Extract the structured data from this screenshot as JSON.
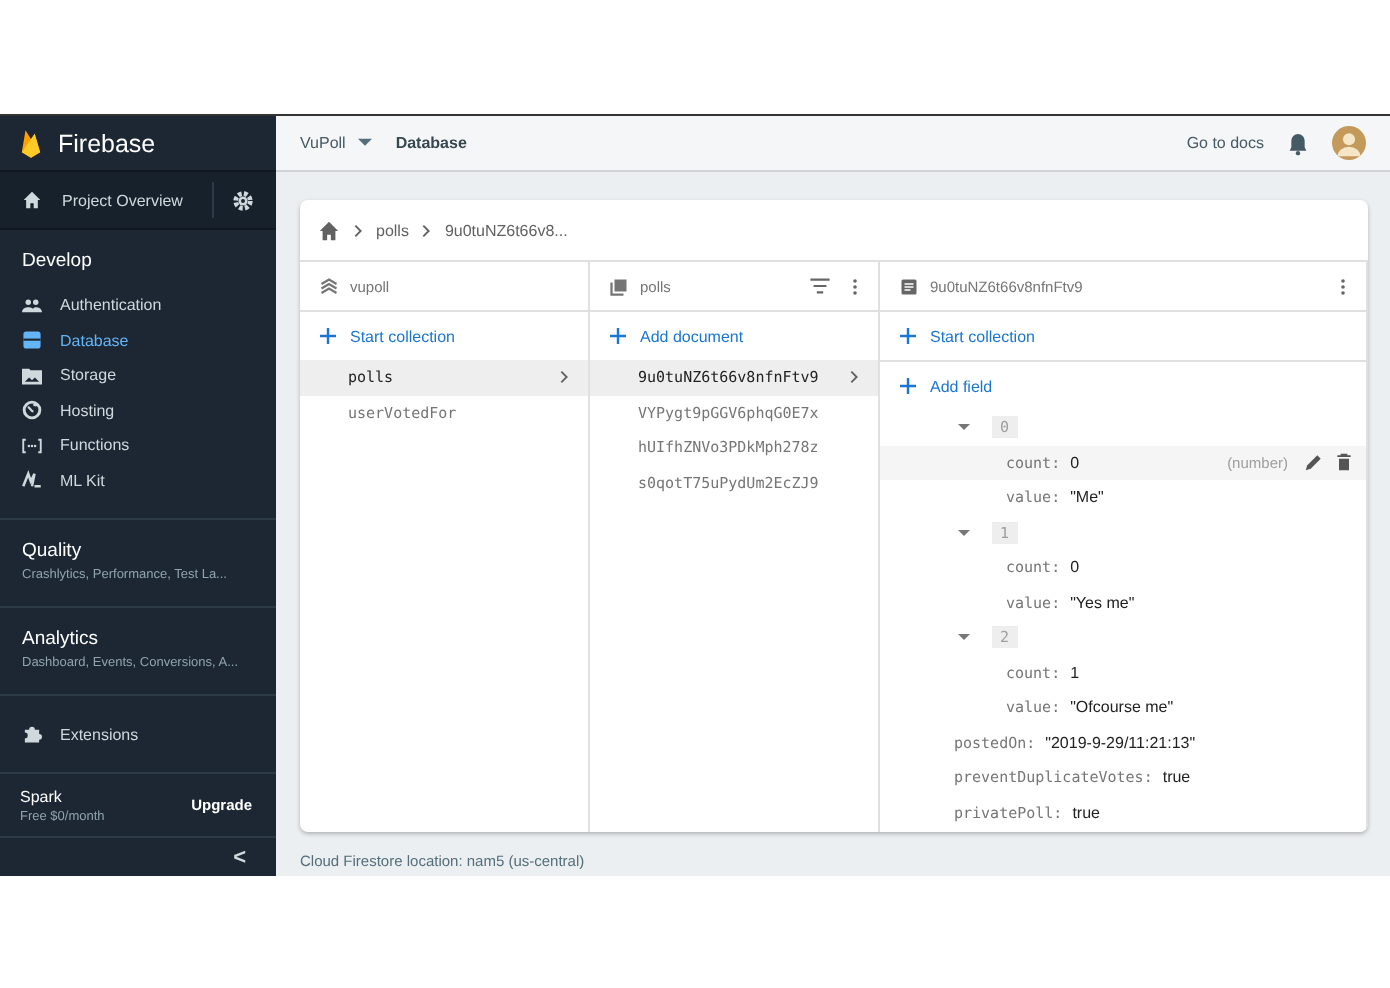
{
  "sidebar": {
    "brand": "Firebase",
    "overview": "Project Overview",
    "develop": {
      "title": "Develop",
      "items": [
        {
          "label": "Authentication",
          "selected": false
        },
        {
          "label": "Database",
          "selected": true
        },
        {
          "label": "Storage",
          "selected": false
        },
        {
          "label": "Hosting",
          "selected": false
        },
        {
          "label": "Functions",
          "selected": false
        },
        {
          "label": "ML Kit",
          "selected": false
        }
      ]
    },
    "sections": [
      {
        "title": "Quality",
        "subtitle": "Crashlytics, Performance, Test La..."
      },
      {
        "title": "Analytics",
        "subtitle": "Dashboard, Events, Conversions, A..."
      }
    ],
    "extensions": "Extensions",
    "plan": {
      "name": "Spark",
      "price": "Free $0/month",
      "action": "Upgrade"
    },
    "collapse": "<"
  },
  "topbar": {
    "project": "VuPoll",
    "page": "Database",
    "docs": "Go to docs"
  },
  "breadcrumb": [
    "polls",
    "9u0tuNZ6t66v8..."
  ],
  "columns": [
    {
      "title": "vupoll",
      "action": "Start collection",
      "items": [
        {
          "label": "polls",
          "selected": true
        },
        {
          "label": "userVotedFor",
          "selected": false
        }
      ]
    },
    {
      "title": "polls",
      "action": "Add document",
      "items": [
        {
          "label": "9u0tuNZ6t66v8nfnFtv9",
          "selected": true
        },
        {
          "label": "VYPygt9pGGV6phqG0E7x",
          "selected": false
        },
        {
          "label": "hUIfhZNVo3PDkMph278z",
          "selected": false
        },
        {
          "label": "s0qotT75uPydUm2EcZJ9",
          "selected": false
        }
      ]
    }
  ],
  "document": {
    "title": "9u0tuNZ6t66v8nfnFtv9",
    "action": "Start collection",
    "add_field": "Add field",
    "fields": [
      {
        "kind": "map",
        "key": "0",
        "expanded": true,
        "children": [
          {
            "kind": "value",
            "key": "count:",
            "value": "0",
            "selected": true,
            "type": "(number)"
          },
          {
            "kind": "value",
            "key": "value:",
            "value": "\"Me\"",
            "selected": false
          }
        ]
      },
      {
        "kind": "map",
        "key": "1",
        "expanded": true,
        "children": [
          {
            "kind": "value",
            "key": "count:",
            "value": "0",
            "selected": false
          },
          {
            "kind": "value",
            "key": "value:",
            "value": "\"Yes me\"",
            "selected": false
          }
        ]
      },
      {
        "kind": "map",
        "key": "2",
        "expanded": true,
        "children": [
          {
            "kind": "value",
            "key": "count:",
            "value": "1",
            "selected": false
          },
          {
            "kind": "value",
            "key": "value:",
            "value": "\"Ofcourse me\"",
            "selected": false
          }
        ]
      },
      {
        "kind": "value",
        "key": "postedOn:",
        "value": "\"2019-9-29/11:21:13\"",
        "selected": false
      },
      {
        "kind": "value",
        "key": "preventDuplicateVotes:",
        "value": "true",
        "selected": false
      },
      {
        "kind": "value",
        "key": "privatePoll:",
        "value": "true",
        "selected": false
      }
    ]
  },
  "footer": "Cloud Firestore location: nam5 (us-central)"
}
